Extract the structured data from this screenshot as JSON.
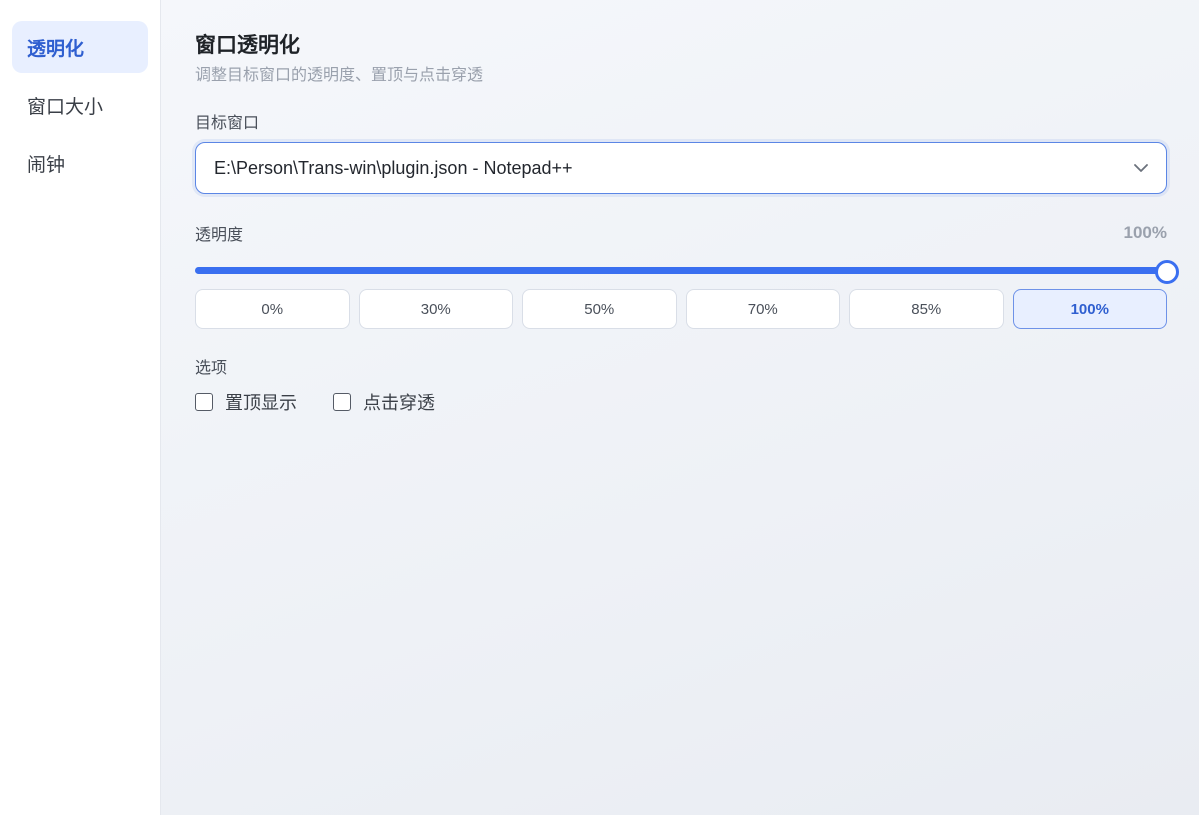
{
  "sidebar": {
    "items": [
      {
        "label": "透明化",
        "active": true
      },
      {
        "label": "窗口大小",
        "active": false
      },
      {
        "label": "闹钟",
        "active": false
      }
    ]
  },
  "main": {
    "title": "窗口透明化",
    "subtitle": "调整目标窗口的透明度、置顶与点击穿透",
    "target_window": {
      "label": "目标窗口",
      "value": "E:\\Person\\Trans-win\\plugin.json - Notepad++",
      "icon": "chevron-down-icon"
    },
    "opacity": {
      "label": "透明度",
      "value_text": "100%",
      "value": 100,
      "presets": [
        "0%",
        "30%",
        "50%",
        "70%",
        "85%",
        "100%"
      ],
      "selected_preset": "100%"
    },
    "options": {
      "label": "选项",
      "items": [
        {
          "label": "置顶显示",
          "checked": false
        },
        {
          "label": "点击穿透",
          "checked": false
        }
      ]
    }
  },
  "colors": {
    "accent": "#3a6ff0",
    "accent_text": "#2f5fd0",
    "active_bg": "#e8efff",
    "muted_text": "#9aa1ad"
  }
}
